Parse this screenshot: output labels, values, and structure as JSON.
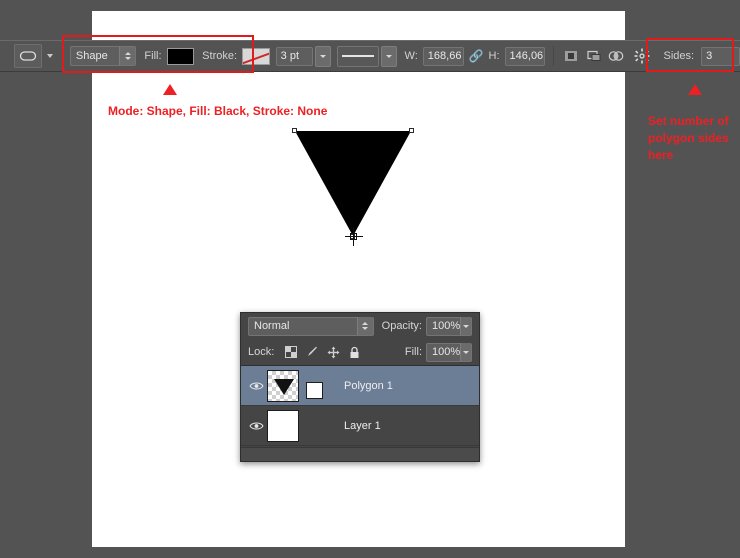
{
  "app": {
    "background_color": "#535353",
    "canvas_color": "#ffffff"
  },
  "options_bar": {
    "tool_preset_icon": "shape-tool-icon",
    "tool_preset_dropdown_icon": "chevron-down-icon",
    "mode_value": "Shape",
    "fill_label": "Fill:",
    "fill_color": "#000000",
    "stroke_label": "Stroke:",
    "stroke_value": "none",
    "stroke_width_value": "3 pt",
    "stroke_style_icon": "solid-line-icon",
    "width_label": "W:",
    "width_value": "168,66 ",
    "link_icon": "link-chain-icon",
    "height_label": "H:",
    "height_value": "146,06 ",
    "path_align_icon": "path-alignment-icon",
    "path_arrange_icon": "path-arrangement-icon",
    "path_ops_icon": "path-operations-icon",
    "gear_icon": "gear-icon",
    "sides_label": "Sides:",
    "sides_value": "3"
  },
  "annotations": {
    "options_note": "Mode: Shape, Fill: Black, Stroke: None",
    "sides_note_line1": "Set number of",
    "sides_note_line2": "polygon sides",
    "sides_note_line3": "here",
    "accent_color": "#ed2024"
  },
  "canvas": {
    "shape_name": "polygon-triangle",
    "shape_fill": "#000000",
    "crosshair_name": "polygon-tool-cursor"
  },
  "layers_panel": {
    "blend_mode": "Normal",
    "opacity_label": "Opacity:",
    "opacity_value": "100%",
    "lock_label": "Lock:",
    "lock_icons": [
      "lock-transparent-pixels-icon",
      "lock-image-pixels-icon",
      "lock-position-icon",
      "lock-all-icon"
    ],
    "fill_label": "Fill:",
    "fill_value": "100%",
    "layers": [
      {
        "name": "Polygon 1",
        "visible": true,
        "selected": true,
        "thumb_type": "vector-shape",
        "has_vector_mask": true
      },
      {
        "name": "Layer 1",
        "visible": true,
        "selected": false,
        "thumb_type": "white-fill",
        "has_vector_mask": false
      }
    ]
  }
}
